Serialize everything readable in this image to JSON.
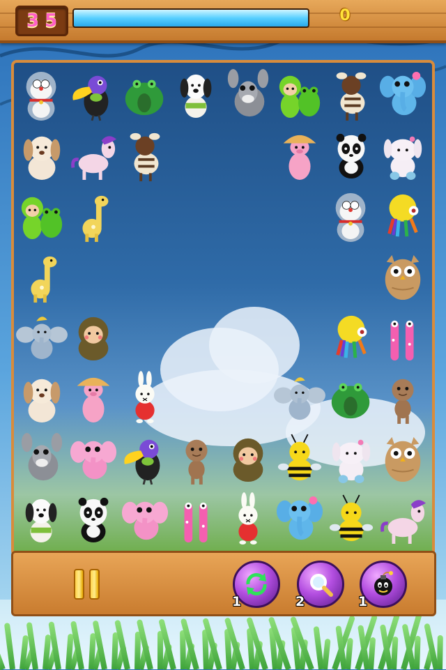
{
  "hud": {
    "level": "35",
    "timer_fraction": 1.0,
    "score": "0"
  },
  "colors": {
    "wood": "#d98c3b",
    "level_digits": "#ff5fc7",
    "timer_fill": "#58cfff",
    "score_digits": "#ffe13a",
    "power_button": "#b34ee0"
  },
  "board": {
    "tiles": [
      {
        "row": 0,
        "col": 0,
        "toy": "doraemon"
      },
      {
        "row": 0,
        "col": 1,
        "toy": "toucan"
      },
      {
        "row": 0,
        "col": 2,
        "toy": "green-frog"
      },
      {
        "row": 0,
        "col": 3,
        "toy": "snoopy-dog"
      },
      {
        "row": 0,
        "col": 4,
        "toy": "grey-donkey"
      },
      {
        "row": 0,
        "col": 5,
        "toy": "frog-kid"
      },
      {
        "row": 0,
        "col": 6,
        "toy": "zebra"
      },
      {
        "row": 0,
        "col": 7,
        "toy": "blue-elephant"
      },
      {
        "row": 1,
        "col": 0,
        "toy": "puppy"
      },
      {
        "row": 1,
        "col": 1,
        "toy": "pony"
      },
      {
        "row": 1,
        "col": 2,
        "toy": "zebra"
      },
      {
        "row": 1,
        "col": 5,
        "toy": "mushroom-pig"
      },
      {
        "row": 1,
        "col": 6,
        "toy": "panda"
      },
      {
        "row": 1,
        "col": 7,
        "toy": "white-bunny"
      },
      {
        "row": 2,
        "col": 0,
        "toy": "frog-kid"
      },
      {
        "row": 2,
        "col": 1,
        "toy": "giraffe"
      },
      {
        "row": 2,
        "col": 6,
        "toy": "doraemon"
      },
      {
        "row": 2,
        "col": 7,
        "toy": "octopus"
      },
      {
        "row": 3,
        "col": 0,
        "toy": "giraffe"
      },
      {
        "row": 3,
        "col": 7,
        "toy": "owl"
      },
      {
        "row": 4,
        "col": 0,
        "toy": "dumbo"
      },
      {
        "row": 4,
        "col": 1,
        "toy": "monkey"
      },
      {
        "row": 4,
        "col": 6,
        "toy": "octopus"
      },
      {
        "row": 4,
        "col": 7,
        "toy": "pink-giraffe"
      },
      {
        "row": 5,
        "col": 0,
        "toy": "puppy"
      },
      {
        "row": 5,
        "col": 1,
        "toy": "mushroom-pig"
      },
      {
        "row": 5,
        "col": 2,
        "toy": "miffy"
      },
      {
        "row": 5,
        "col": 5,
        "toy": "dumbo"
      },
      {
        "row": 5,
        "col": 6,
        "toy": "green-frog"
      },
      {
        "row": 5,
        "col": 7,
        "toy": "sackboy"
      },
      {
        "row": 6,
        "col": 0,
        "toy": "grey-donkey"
      },
      {
        "row": 6,
        "col": 1,
        "toy": "pink-elephant"
      },
      {
        "row": 6,
        "col": 2,
        "toy": "toucan"
      },
      {
        "row": 6,
        "col": 3,
        "toy": "sackboy"
      },
      {
        "row": 6,
        "col": 4,
        "toy": "monkey"
      },
      {
        "row": 6,
        "col": 5,
        "toy": "bee"
      },
      {
        "row": 6,
        "col": 6,
        "toy": "white-bunny"
      },
      {
        "row": 6,
        "col": 7,
        "toy": "owl"
      },
      {
        "row": 7,
        "col": 0,
        "toy": "snoopy-dog"
      },
      {
        "row": 7,
        "col": 1,
        "toy": "panda"
      },
      {
        "row": 7,
        "col": 2,
        "toy": "pink-elephant"
      },
      {
        "row": 7,
        "col": 3,
        "toy": "pink-giraffe"
      },
      {
        "row": 7,
        "col": 4,
        "toy": "miffy"
      },
      {
        "row": 7,
        "col": 5,
        "toy": "blue-elephant"
      },
      {
        "row": 7,
        "col": 6,
        "toy": "bee"
      },
      {
        "row": 7,
        "col": 7,
        "toy": "pony"
      }
    ]
  },
  "controls": {
    "pause_icon": "pause-icon",
    "powerups": [
      {
        "name": "shuffle",
        "icon": "shuffle-icon",
        "count": "1"
      },
      {
        "name": "hint",
        "icon": "magnifier-icon",
        "count": "2"
      },
      {
        "name": "bomb",
        "icon": "bomb-icon",
        "count": "1"
      }
    ]
  }
}
